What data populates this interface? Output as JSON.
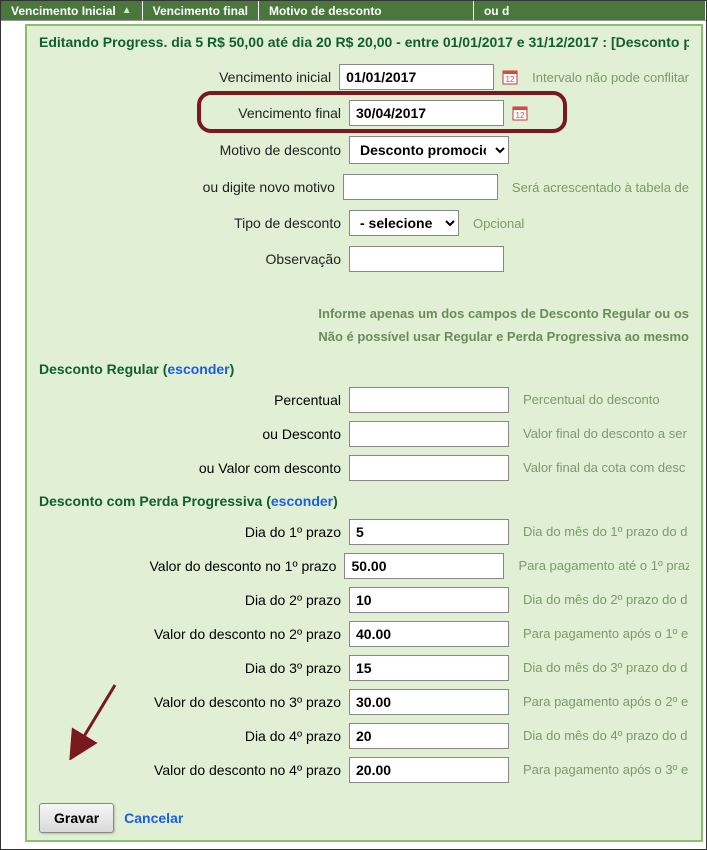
{
  "tabs": {
    "col1": "Vencimento Inicial",
    "col2": "Vencimento final",
    "col3": "Motivo de desconto",
    "col4": "ou d"
  },
  "editTitle": "Editando Progress. dia 5 R$ 50,00 até dia 20 R$ 20,00 - entre 01/01/2017 e 31/12/2017 : [Desconto promocional]",
  "form": {
    "vencInicial": {
      "label": "Vencimento inicial",
      "value": "01/01/2017",
      "hint": "Intervalo não pode conflitar"
    },
    "vencFinal": {
      "label": "Vencimento final",
      "value": "30/04/2017"
    },
    "motivo": {
      "label": "Motivo de desconto",
      "value": "Desconto promocional"
    },
    "novoMotivo": {
      "label": "ou digite novo motivo",
      "value": "",
      "hint": "Será acrescentado à tabela de"
    },
    "tipoDesconto": {
      "label": "Tipo de desconto",
      "value": "- selecione -",
      "hint": "Opcional"
    },
    "observacao": {
      "label": "Observação",
      "value": ""
    }
  },
  "infoLines": {
    "l1": "Informe apenas um dos campos de Desconto Regular ou os",
    "l2": "Não é possível usar Regular e Perda Progressiva ao mesmo"
  },
  "sections": {
    "regular": {
      "title": "Desconto Regular",
      "link": "esconder"
    },
    "progressiva": {
      "title": "Desconto com Perda Progressiva",
      "link": "esconder"
    }
  },
  "regular": {
    "percentual": {
      "label": "Percentual",
      "value": "",
      "hint": "Percentual do desconto"
    },
    "desconto": {
      "label": "ou Desconto",
      "value": "",
      "hint": "Valor final do desconto a ser"
    },
    "valorCom": {
      "label": "ou Valor com desconto",
      "value": "",
      "hint": "Valor final da cota com desc"
    }
  },
  "prog": {
    "d1": {
      "label": "Dia do 1º prazo",
      "value": "5",
      "hint": "Dia do mês do 1º prazo do d"
    },
    "v1": {
      "label": "Valor do desconto no 1º prazo",
      "value": "50.00",
      "hint": "Para pagamento até o 1º praz"
    },
    "d2": {
      "label": "Dia do 2º prazo",
      "value": "10",
      "hint": "Dia do mês do 2º prazo do d"
    },
    "v2": {
      "label": "Valor do desconto no 2º prazo",
      "value": "40.00",
      "hint": "Para pagamento após o 1º e"
    },
    "d3": {
      "label": "Dia do 3º prazo",
      "value": "15",
      "hint": "Dia do mês do 3º prazo do d"
    },
    "v3": {
      "label": "Valor do desconto no 3º prazo",
      "value": "30.00",
      "hint": "Para pagamento após o 2º e"
    },
    "d4": {
      "label": "Dia do 4º prazo",
      "value": "20",
      "hint": "Dia do mês do 4º prazo do d"
    },
    "v4": {
      "label": "Valor do desconto no 4º prazo",
      "value": "20.00",
      "hint": "Para pagamento após o 3º e"
    }
  },
  "buttons": {
    "gravar": "Gravar",
    "cancelar": "Cancelar"
  }
}
